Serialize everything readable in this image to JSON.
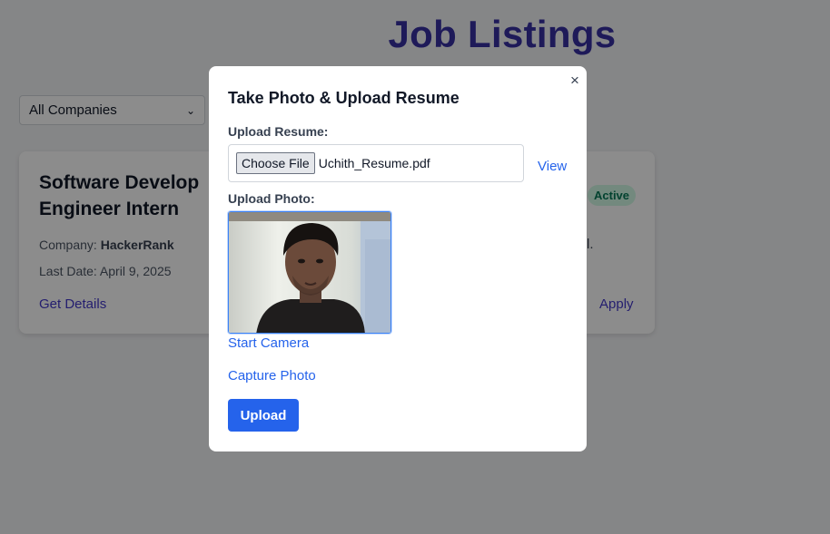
{
  "page": {
    "title": "Job Listings",
    "filter": {
      "selected": "All Companies"
    }
  },
  "job_card": {
    "title": "Software Developer Engineer Intern",
    "title_visible_line1": "Software Develop",
    "title_visible_line2": "Engineer Intern",
    "company_label": "Company:",
    "company_name": "HackerRank",
    "last_date": "Last Date: April 9, 2025",
    "details_link": "Get Details",
    "status_badge": "Active",
    "description_tail": "l.",
    "apply_link": "Apply"
  },
  "modal": {
    "title": "Take Photo & Upload Resume",
    "close_symbol": "×",
    "resume_label": "Upload Resume:",
    "choose_file_label": "Choose File",
    "file_name": "Uchith_Resume.pdf",
    "view_link": "View",
    "photo_label": "Upload Photo:",
    "start_camera": "Start Camera",
    "capture_photo": "Capture Photo",
    "upload_button": "Upload"
  },
  "colors": {
    "accent": "#2563eb",
    "title": "#3730a3",
    "badge_bg": "#d1fae5",
    "badge_text": "#047857"
  }
}
